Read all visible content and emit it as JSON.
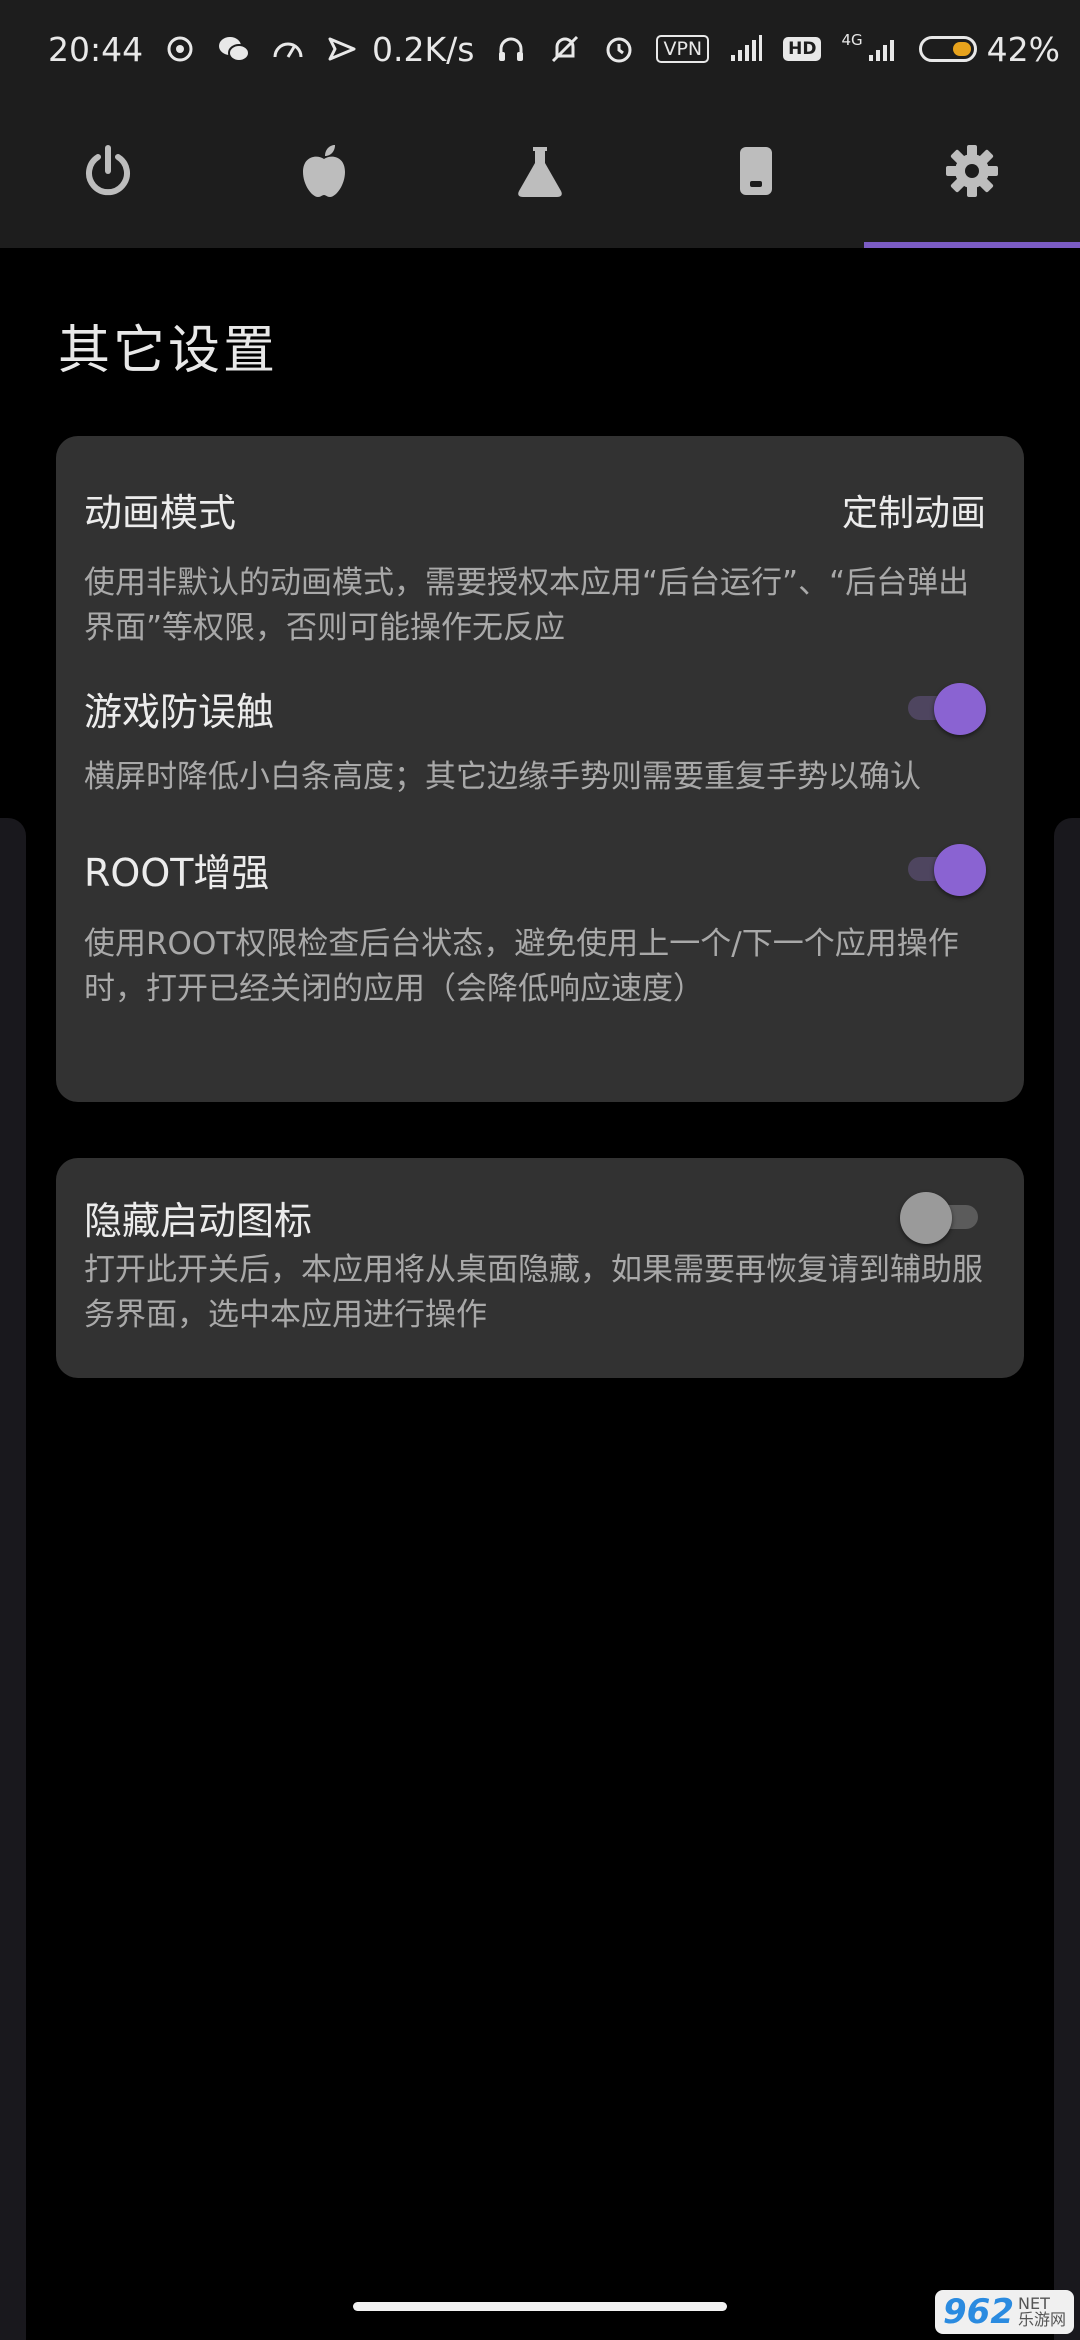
{
  "status_bar": {
    "time": "20:44",
    "net_speed": "0.2K/s",
    "vpn": "VPN",
    "hd": "HD",
    "network_type": "4G",
    "battery": "42%",
    "icons": [
      "netease-icon",
      "wechat-icon",
      "speedometer-icon",
      "send-icon",
      "headphones-icon",
      "mute-icon",
      "alarm-icon",
      "signal-icon",
      "signal-4g-icon",
      "battery-icon"
    ]
  },
  "tabs": [
    {
      "icon": "power-icon"
    },
    {
      "icon": "apple-icon"
    },
    {
      "icon": "flask-icon"
    },
    {
      "icon": "phone-icon"
    },
    {
      "icon": "gear-icon",
      "active": true
    }
  ],
  "page": {
    "title": "其它设置"
  },
  "card1": {
    "animation": {
      "title": "动画模式",
      "value": "定制动画",
      "desc": "使用非默认的动画模式，需要授权本应用“后台运行”、“后台弹出界面”等权限，否则可能操作无反应"
    },
    "game_guard": {
      "title": "游戏防误触",
      "desc": "横屏时降低小白条高度；其它边缘手势则需要重复手势以确认",
      "enabled": true
    },
    "root_boost": {
      "title": "ROOT增强",
      "desc": "使用ROOT权限检查后台状态，避免使用上一个/下一个应用操作时，打开已经关闭的应用（会降低响应速度）",
      "enabled": true
    }
  },
  "card2": {
    "hide_icon": {
      "title": "隐藏启动图标",
      "desc": "打开此开关后，本应用将从桌面隐藏，如果需要再恢复请到辅助服务界面，选中本应用进行操作",
      "enabled": false
    }
  },
  "watermark": {
    "number": "962",
    "net": "NET",
    "site": "乐游网"
  },
  "colors": {
    "accent": "#7b5cc4",
    "card": "#323232",
    "bar": "#1d1d1d"
  }
}
